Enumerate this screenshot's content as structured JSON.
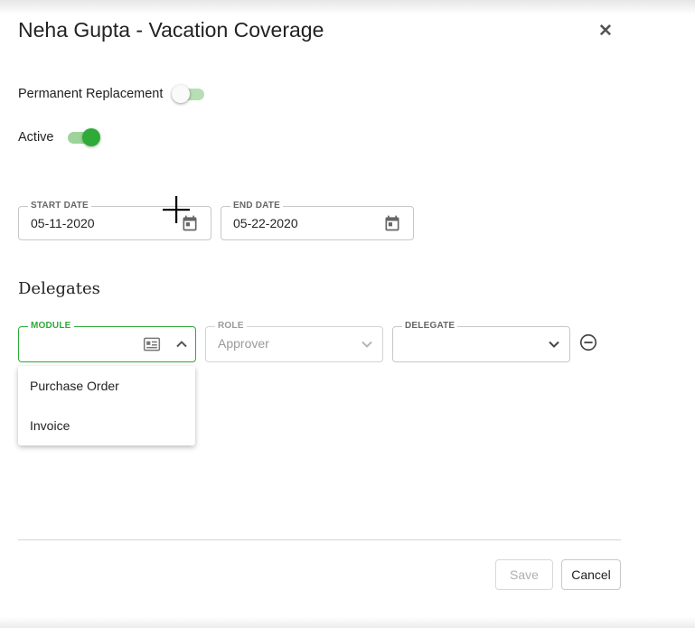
{
  "dialog": {
    "title": "Neha Gupta - Vacation Coverage",
    "close_icon": "close-icon"
  },
  "toggles": {
    "permanent_replacement": {
      "label": "Permanent Replacement",
      "checked": false
    },
    "active": {
      "label": "Active",
      "checked": true
    }
  },
  "dates": {
    "start": {
      "label": "START DATE",
      "value": "05-11-2020",
      "icon": "calendar-icon"
    },
    "end": {
      "label": "END DATE",
      "value": "05-22-2020",
      "icon": "calendar-icon"
    }
  },
  "delegates": {
    "section_title": "Delegates",
    "module": {
      "label": "MODULE",
      "value": "",
      "icon": "id-card-icon",
      "expanded": true
    },
    "role": {
      "label": "ROLE",
      "value": "Approver"
    },
    "delegate": {
      "label": "DELEGATE",
      "value": ""
    },
    "remove_icon": "remove-circle-icon",
    "module_options": [
      "Purchase Order",
      "Invoice"
    ]
  },
  "footer": {
    "save_label": "Save",
    "cancel_label": "Cancel"
  },
  "colors": {
    "accent": "#2eaa39",
    "toggle_track_on": "#9ed49a",
    "toggle_track_off": "#b7deb4",
    "border": "#c8c8c8"
  }
}
